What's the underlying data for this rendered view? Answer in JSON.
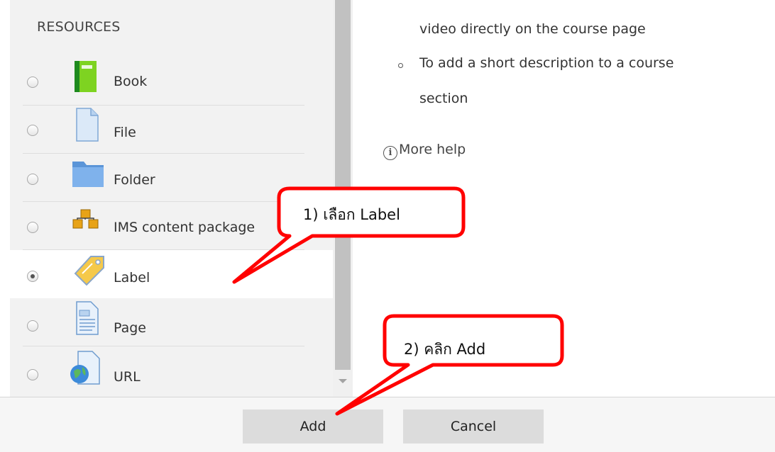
{
  "sidebar": {
    "section_title": "RESOURCES",
    "items": [
      {
        "label": "Book",
        "icon": "book-icon",
        "selected": false
      },
      {
        "label": "File",
        "icon": "file-icon",
        "selected": false
      },
      {
        "label": "Folder",
        "icon": "folder-icon",
        "selected": false
      },
      {
        "label": "IMS content package",
        "icon": "ims-package-icon",
        "selected": false
      },
      {
        "label": "Label",
        "icon": "label-tag-icon",
        "selected": true
      },
      {
        "label": "Page",
        "icon": "page-icon",
        "selected": false
      },
      {
        "label": "URL",
        "icon": "url-globe-icon",
        "selected": false
      }
    ]
  },
  "help": {
    "line1": "video directly on the course page",
    "line2": "To add a short description to a course",
    "line3": "section",
    "more_help": "More help"
  },
  "footer": {
    "add_label": "Add",
    "cancel_label": "Cancel"
  },
  "annotations": {
    "step1": "1) เลือก Label",
    "step2": "2)  คลิก Add",
    "color": "#ff0000"
  }
}
